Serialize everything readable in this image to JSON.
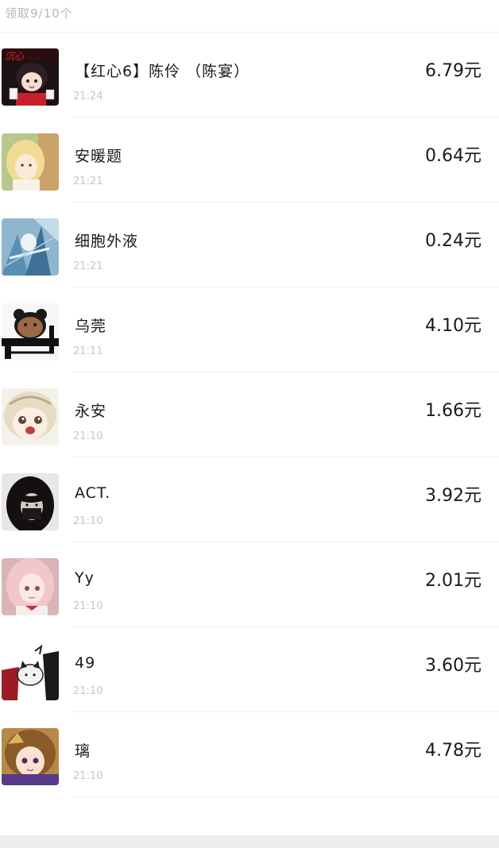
{
  "header": {
    "text": "领取9/10个"
  },
  "claims": [
    {
      "name": "【红心6】陈伶 （陈宴）",
      "time": "21:24",
      "amount": "6.79元",
      "avatar": "avatar-red-chibi-icon"
    },
    {
      "name": "安暖题",
      "time": "21:21",
      "amount": "0.64元",
      "avatar": "avatar-blonde-girl-icon"
    },
    {
      "name": "细胞外液",
      "time": "21:21",
      "amount": "0.24元",
      "avatar": "avatar-blue-fantasy-icon"
    },
    {
      "name": "乌莞",
      "time": "21:11",
      "amount": "4.10元",
      "avatar": "avatar-bear-doodle-icon"
    },
    {
      "name": "永安",
      "time": "21:10",
      "amount": "1.66元",
      "avatar": "avatar-crying-chibi-icon"
    },
    {
      "name": "ACT.",
      "time": "21:10",
      "amount": "3.92元",
      "avatar": "avatar-dark-hair-icon"
    },
    {
      "name": "Yy",
      "time": "21:10",
      "amount": "2.01元",
      "avatar": "avatar-pink-anime-icon"
    },
    {
      "name": "49",
      "time": "21:10",
      "amount": "3.60元",
      "avatar": "avatar-cat-sketch-icon"
    },
    {
      "name": "璃",
      "time": "21:10",
      "amount": "4.78元",
      "avatar": "avatar-anime-girl-icon"
    }
  ],
  "colors": {
    "text_primary": "#1a1a1a",
    "text_secondary": "#c6c6c6",
    "divider": "#efefef"
  }
}
